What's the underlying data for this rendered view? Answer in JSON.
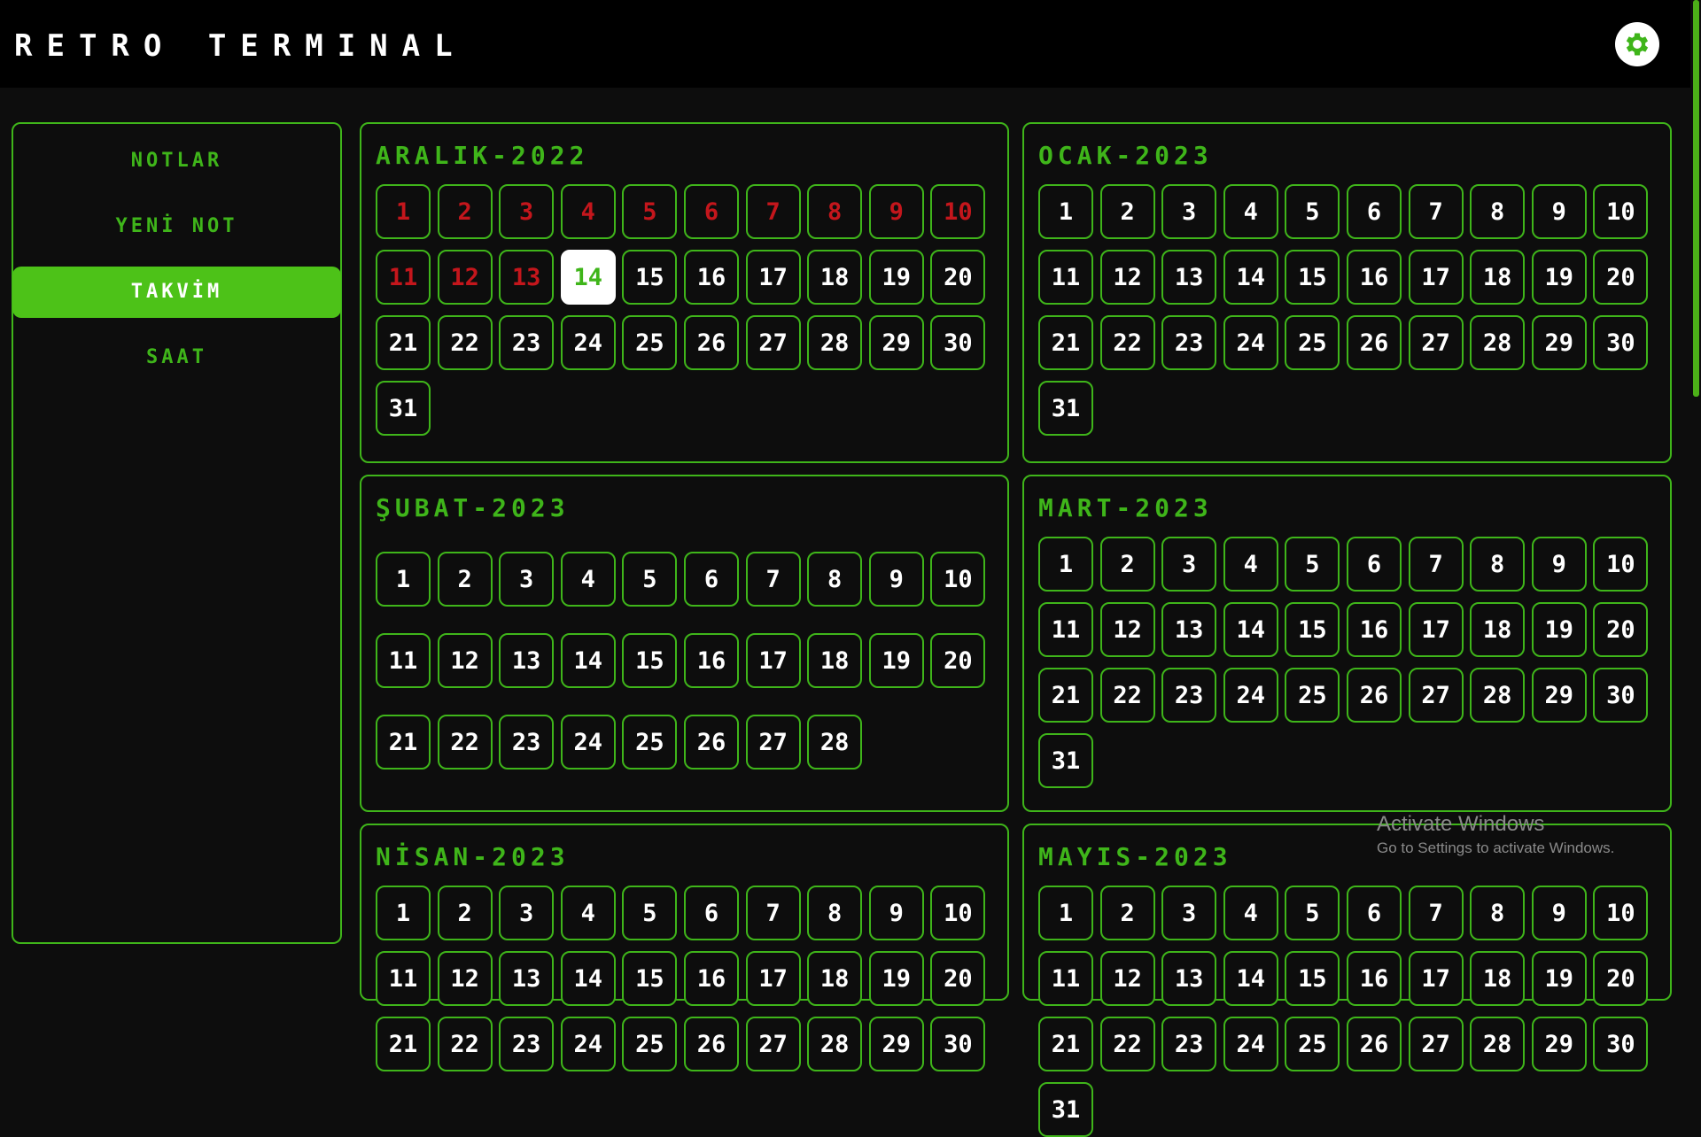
{
  "app": {
    "title": "RETRO TERMINAL"
  },
  "header": {
    "settings_icon": "gear-icon"
  },
  "sidebar": {
    "items": [
      {
        "label": "NOTLAR",
        "active": false
      },
      {
        "label": "YENİ NOT",
        "active": false
      },
      {
        "label": "TAKVİM",
        "active": true
      },
      {
        "label": "SAAT",
        "active": false
      }
    ]
  },
  "calendar": {
    "today": {
      "month_index": 0,
      "day": 14
    },
    "months": [
      {
        "title": "ARALIK-2022",
        "days": 31
      },
      {
        "title": "OCAK-2023",
        "days": 31
      },
      {
        "title": "ŞUBAT-2023",
        "days": 28
      },
      {
        "title": "MART-2023",
        "days": 31
      },
      {
        "title": "NİSAN-2023",
        "days": 30
      },
      {
        "title": "MAYIS-2023",
        "days": 31
      }
    ]
  },
  "watermark": {
    "title": "Activate Windows",
    "subtitle": "Go to Settings to activate Windows."
  },
  "colors": {
    "accent": "#3fb51a",
    "past_day": "#c4161c",
    "today_bg": "#ffffff",
    "background": "#0d0d0d",
    "topbar": "#000000"
  }
}
